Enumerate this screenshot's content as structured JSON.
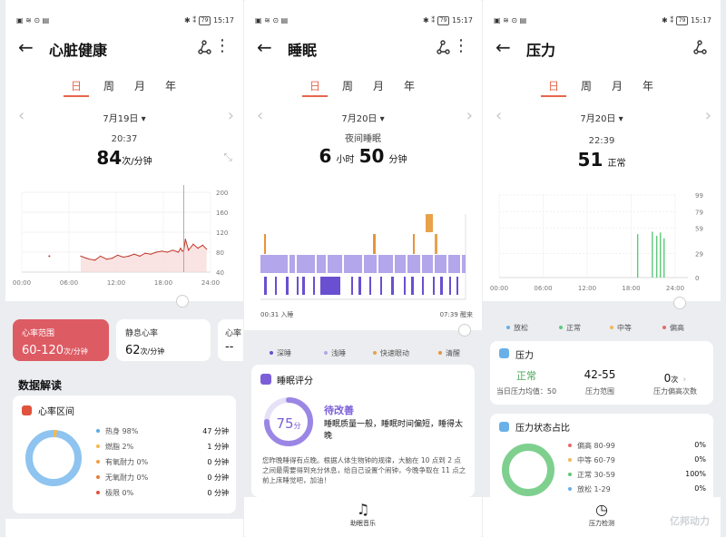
{
  "status": {
    "time": "15:17",
    "battery": "79"
  },
  "tabs": [
    "日",
    "周",
    "月",
    "年"
  ],
  "icons": {
    "back": "arrow-left-icon",
    "share": "share-icon",
    "more": "more-vertical-icon",
    "music": "music-note-icon",
    "timer": "stopwatch-icon"
  },
  "colors": {
    "accent": "#e5664b",
    "hr_line": "#c0392b",
    "hr_fill": "#f8d9d9",
    "deep": "#6a4fd0",
    "light": "#b3a6ea",
    "rem": "#e8a24a",
    "awake": "#e8943a",
    "relax": "#6ab0e8",
    "normal": "#5dc97a",
    "moderate": "#f0b65a",
    "high": "#e46a6a"
  },
  "heart": {
    "title": "心脏健康",
    "date": "7月19日",
    "time": "20:37",
    "value": "84",
    "unit": "次/分钟",
    "range_label": "心率范围",
    "range_value": "60-120",
    "range_unit": "次/分钟",
    "rest_label": "静息心率",
    "rest_value": "62",
    "rest_unit": "次/分钟",
    "third_label": "心率",
    "third_value": "--",
    "section_title": "数据解读",
    "zone_title": "心率区间",
    "zones": [
      {
        "name": "热身 98%",
        "value": "47 分钟",
        "color": "#5aa9e6"
      },
      {
        "name": "燃脂 2%",
        "value": "1 分钟",
        "color": "#f5b84c"
      },
      {
        "name": "有氧耐力 0%",
        "value": "0 分钟",
        "color": "#f0a040"
      },
      {
        "name": "无氧耐力 0%",
        "value": "0 分钟",
        "color": "#e57f3a"
      },
      {
        "name": "极限 0%",
        "value": "0 分钟",
        "color": "#e0533d"
      }
    ]
  },
  "sleep": {
    "title": "睡眠",
    "date": "7月20日",
    "label": "夜间睡眠",
    "hours": "6",
    "hours_unit": "小时",
    "minutes": "50",
    "minutes_unit": "分钟",
    "start": "00:31 入睡",
    "end": "07:39 醒来",
    "legend": [
      "深睡",
      "浅睡",
      "快速眼动",
      "清醒"
    ],
    "score_title": "睡眠评分",
    "score": "75",
    "score_unit": "分",
    "score_status": "待改善",
    "score_summary": "睡眠质量一般，睡眠时间偏短，睡得太晚",
    "advice": "您昨晚睡得有点晚。根据人体生物钟的规律，大脑在 10 点到 2 点之间最需要得到充分休息，给自己设置个闹钟，今晚争取在 11 点之前上床睡觉吧，加油！",
    "music": "助眠音乐"
  },
  "stress": {
    "title": "压力",
    "date": "7月20日",
    "time": "22:39",
    "value": "51",
    "status": "正常",
    "legend": [
      "放松",
      "正常",
      "中等",
      "偏高"
    ],
    "card_title": "压力",
    "avg_status": "正常",
    "avg_label": "当日压力均值：50",
    "range": "42-55",
    "range_label": "压力范围",
    "high_count": "0",
    "high_unit": "次",
    "high_label": "压力偏高次数",
    "states_title": "压力状态占比",
    "states": [
      {
        "name": "偏高 80-99",
        "value": "0%",
        "color": "#e46a6a"
      },
      {
        "name": "中等 60-79",
        "value": "0%",
        "color": "#f0b65a"
      },
      {
        "name": "正常 30-59",
        "value": "100%",
        "color": "#5dc97a"
      },
      {
        "name": "放松 1-29",
        "value": "0%",
        "color": "#6ab0e8"
      }
    ],
    "detect": "压力检测"
  },
  "watermark": "亿邦动力",
  "chart_data": [
    {
      "type": "line",
      "name": "heart-rate",
      "x_ticks": [
        "00:00",
        "06:00",
        "12:00",
        "18:00",
        "24:00"
      ],
      "y_ticks": [
        200,
        160,
        120,
        80,
        40
      ],
      "ylim": [
        40,
        200
      ],
      "x": [
        7.5,
        8.2,
        8.6,
        9.3,
        10.0,
        10.8,
        11.5,
        12.2,
        12.9,
        13.6,
        14.3,
        15.0,
        15.7,
        16.4,
        17.1,
        17.8,
        18.5,
        19.2,
        19.9,
        20.2,
        20.4,
        20.6,
        20.8,
        21.2,
        21.8,
        22.4,
        23.0,
        23.5
      ],
      "y": [
        72,
        68,
        66,
        64,
        72,
        66,
        68,
        74,
        70,
        72,
        76,
        72,
        78,
        76,
        80,
        82,
        80,
        84,
        80,
        88,
        82,
        84,
        106,
        84,
        96,
        88,
        94,
        86
      ],
      "isolated_point": {
        "x": 3.5,
        "y": 72
      },
      "cursor_x": 20.6
    },
    {
      "type": "bar",
      "name": "sleep-stages",
      "x_range": [
        "00:31",
        "07:39"
      ],
      "categories": [
        "深睡",
        "浅睡",
        "快速眼动",
        "清醒"
      ]
    },
    {
      "type": "bar",
      "name": "stress",
      "x_ticks": [
        "00:00",
        "06:00",
        "12:00",
        "18:00",
        "24:00"
      ],
      "y_ticks": [
        99,
        79,
        59,
        29,
        0
      ],
      "ylim": [
        0,
        100
      ],
      "x": [
        18.8,
        20.8,
        21.4,
        21.9,
        22.4
      ],
      "values": [
        52,
        55,
        50,
        54,
        47
      ]
    },
    {
      "type": "pie",
      "name": "heart-zones",
      "values": [
        98,
        2,
        0,
        0,
        0
      ]
    },
    {
      "type": "pie",
      "name": "stress-states",
      "values": [
        0,
        0,
        100,
        0
      ]
    }
  ]
}
